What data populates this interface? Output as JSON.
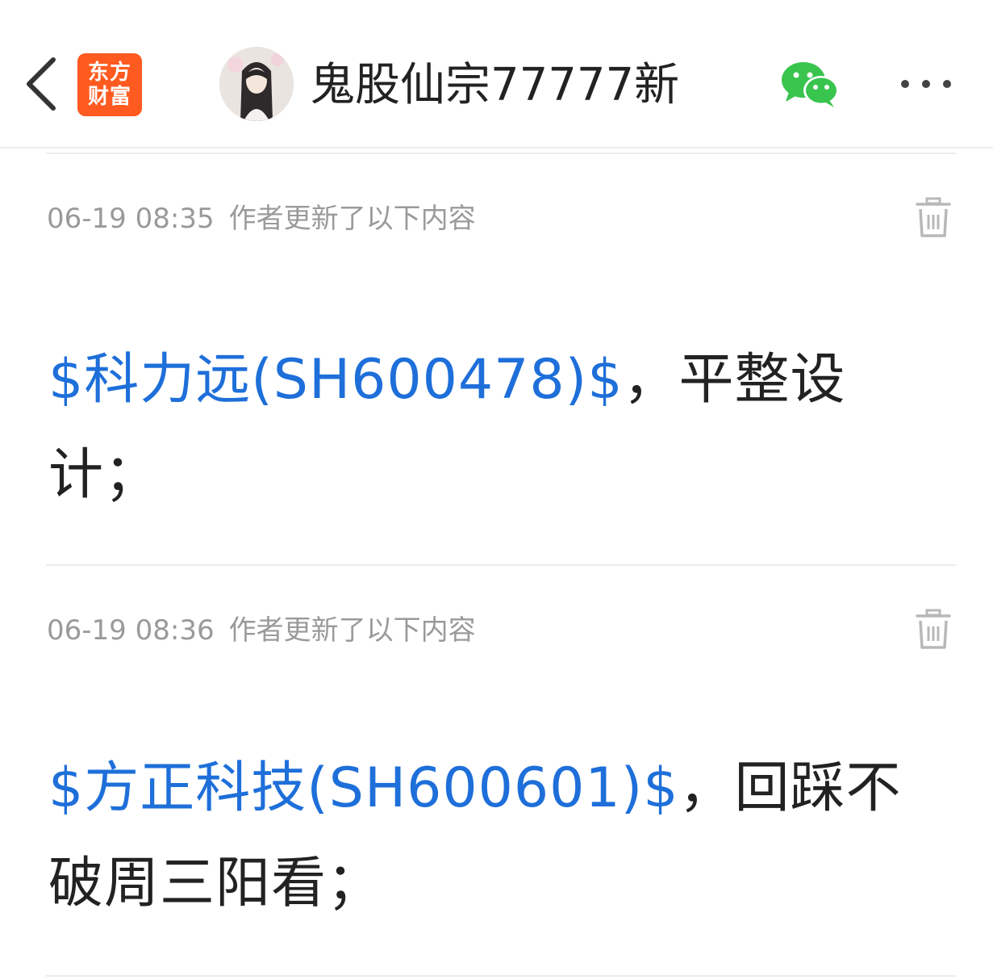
{
  "header": {
    "app_logo_line1": "东方",
    "app_logo_line2": "财富",
    "author_name": "鬼股仙宗77777新"
  },
  "colors": {
    "brand_orange": "#ff5a1f",
    "stock_link_blue": "#1e6fd9",
    "wechat_green": "#39c44e",
    "meta_gray": "#9a9a9a"
  },
  "updates": [
    {
      "timestamp": "06-19 08:35",
      "description": "作者更新了以下内容",
      "stock": "$科力远(SH600478)$",
      "text": "，平整设计；"
    },
    {
      "timestamp": "06-19 08:36",
      "description": "作者更新了以下内容",
      "stock": "$方正科技(SH600601)$",
      "text": "，回踩不破周三阳看；"
    }
  ]
}
